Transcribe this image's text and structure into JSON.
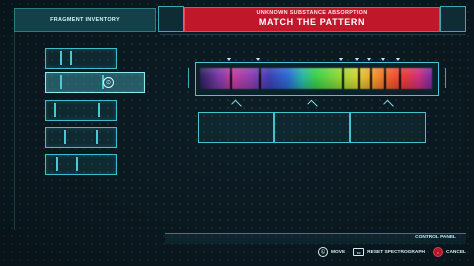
{
  "inventory": {
    "title": "FRAGMENT INVENTORY",
    "slots": [
      {
        "id": "fragment-1",
        "selected": false
      },
      {
        "id": "fragment-2",
        "selected": true
      },
      {
        "id": "fragment-3",
        "selected": false
      },
      {
        "id": "fragment-4",
        "selected": false
      },
      {
        "id": "fragment-5",
        "selected": false
      }
    ],
    "select_glyph": "⊙"
  },
  "header": {
    "subtitle": "UNKNOWN SUBSTANCE ABSORPTION",
    "title": "MATCH THE PATTERN"
  },
  "spectrograph": {
    "absorption_lines_count": 7
  },
  "control_panel": {
    "title": "CONTROL PANEL",
    "controls": [
      {
        "icon": "left-stick-icon",
        "glyph": "Ⓛ",
        "label": "MOVE"
      },
      {
        "icon": "touchpad-icon",
        "glyph": "▭",
        "label": "RESET SPECTROGRAPH"
      },
      {
        "icon": "circle-button-icon",
        "glyph": "○",
        "label": "CANCEL"
      }
    ]
  },
  "colors": {
    "accent": "#3fbccb",
    "banner": "#c0182a",
    "background": "#0d1e26"
  }
}
